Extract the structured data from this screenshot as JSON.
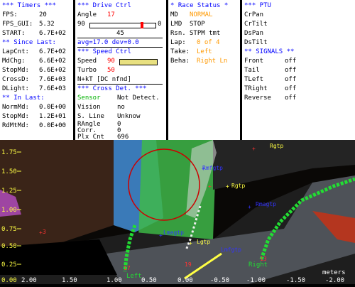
{
  "timers": {
    "title": "*** Timers ***",
    "rows": [
      {
        "label": "FPS:",
        "value": "20"
      },
      {
        "label": "FPS_GUI:",
        "value": "5.32"
      },
      {
        "label": "START:",
        "value": "6.7E+02"
      }
    ],
    "since_title": "** Since Last:",
    "since_rows": [
      {
        "label": "LapCnt:",
        "value": "6.7E+02"
      },
      {
        "label": "MdChg:",
        "value": "6.6E+02"
      },
      {
        "label": "StopMd:",
        "value": "6.6E+02"
      },
      {
        "label": "CrossD:",
        "value": "7.6E+03"
      },
      {
        "label": "DLight:",
        "value": "7.6E+03"
      }
    ],
    "in_title": "** In Last:",
    "in_rows": [
      {
        "label": "NormMd:",
        "value": "0.0E+00"
      },
      {
        "label": "StopMd:",
        "value": "1.2E+01"
      },
      {
        "label": "RdMtMd:",
        "value": "0.0E+00"
      }
    ]
  },
  "drive": {
    "title": "*** Drive Ctrl",
    "angle_label": "Angle",
    "angle_value": "17",
    "slider_min": "90",
    "slider_max": "0",
    "slider_mid": "45",
    "slider_fraction": 0.81,
    "avg_line": "avg=17.0 dev=0.0",
    "speed_title": "*** Speed Ctrl",
    "speed_label": "Speed",
    "speed_value": "90",
    "speed_fraction": 1.0,
    "turbo_label": "Turbo",
    "turbo_value": "50",
    "mode_line": "N+kT [DC nfnd]",
    "cross_title": "*** Cross Det. ***",
    "cross_rows": [
      {
        "label": "Sensor",
        "value": "Not Detect."
      },
      {
        "label": "Vision",
        "value": "no"
      },
      {
        "label": "S. Line",
        "value": "Unknow"
      },
      {
        "label": "RAngle",
        "value": "0"
      },
      {
        "label": "Corr.",
        "value": "0"
      },
      {
        "label": "Plx Cnt",
        "value": "696"
      }
    ]
  },
  "race": {
    "title": "* Race Status *",
    "rows": [
      {
        "label": "MD",
        "value": "NORMAL"
      },
      {
        "label": "LMD",
        "value": "STOP"
      },
      {
        "label": "Rsn.",
        "value": "STPM tmt"
      },
      {
        "label": "Lap:",
        "value": "0 of 4"
      },
      {
        "label": "Take:",
        "value": "Left"
      },
      {
        "label": "Beha:",
        "value": "Right Ln"
      }
    ]
  },
  "ptu": {
    "title": "*** PTU",
    "rows": [
      "CrPan",
      "CrTilt",
      "DsPan",
      "DsTilt"
    ]
  },
  "signals": {
    "title": "** SIGNALS **",
    "rows": [
      {
        "label": "Front",
        "value": "off"
      },
      {
        "label": "Tail",
        "value": "off"
      },
      {
        "label": "TLeft",
        "value": "off"
      },
      {
        "label": "TRight",
        "value": "off"
      },
      {
        "label": "Reverse",
        "value": "off"
      }
    ]
  },
  "scene": {
    "y_ticks": [
      "1.75",
      "1.50",
      "1.25",
      "1.00",
      "0.75",
      "0.50",
      "0.25",
      "0.00"
    ],
    "x_ticks": [
      "2.00",
      "1.50",
      "1.00",
      "0.50",
      "0.00",
      "-0.50",
      "-1.00",
      "-1.50",
      "-2.00"
    ],
    "x_unit": "meters",
    "markers": {
      "rgtp_top": "Rgtp",
      "rmfgtp": "Rmfgtp",
      "rgtp": "Rgtp",
      "rmagtp": "Rmagtp",
      "lmagtp": "Lmagtp",
      "lgtp": "Lgtp",
      "lmfgtp": "Lmfgtp",
      "left": "Left",
      "right": "Right",
      "num_left": "3",
      "num_17": "17",
      "num_13": "13",
      "num_19": "19"
    },
    "colors": {
      "lane": "#22dd33",
      "marker_blue": "#3333ff",
      "marker_yellow": "#ffff44",
      "marker_red": "#ff3333",
      "circle": "#cc0000"
    }
  }
}
